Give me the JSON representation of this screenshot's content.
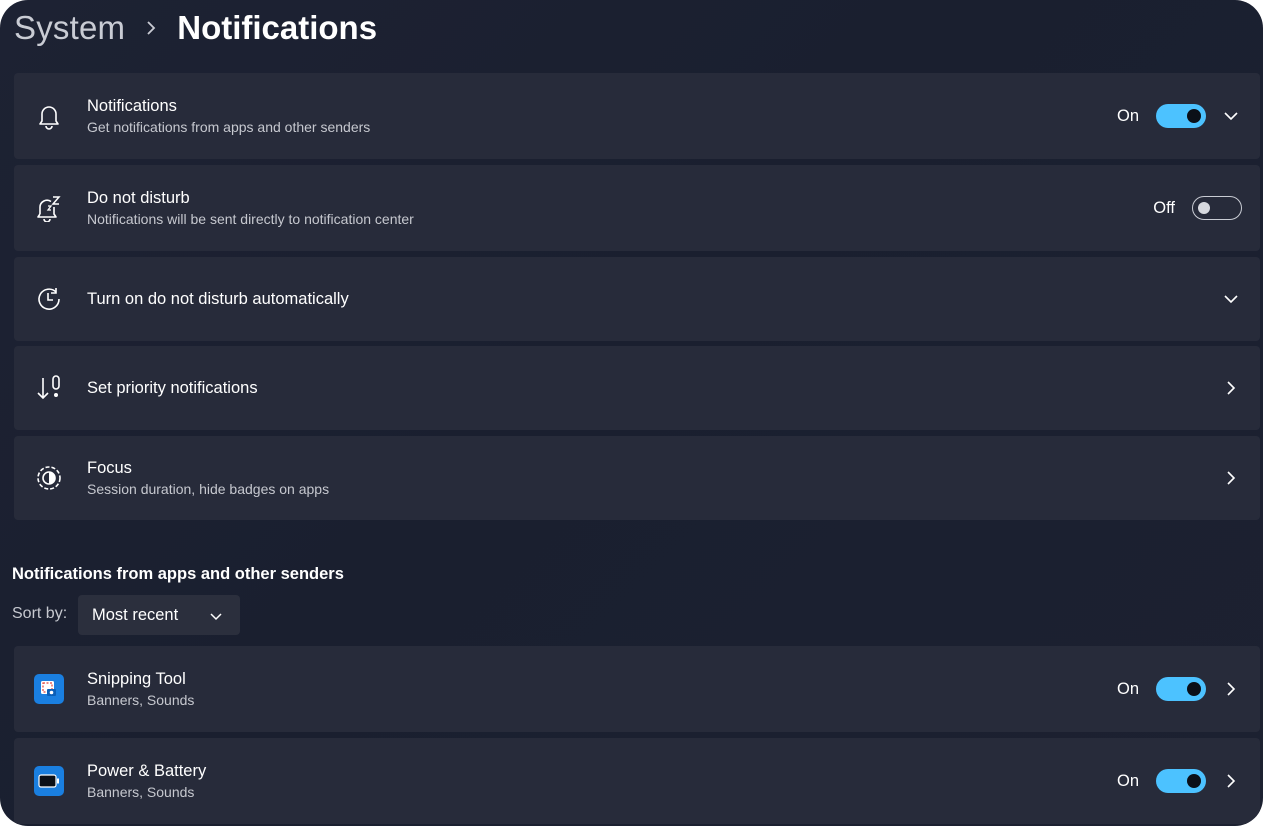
{
  "breadcrumb": {
    "parent": "System",
    "current": "Notifications"
  },
  "colors": {
    "accent": "#4cc2ff",
    "card": "#272b3a",
    "background": "#1d2233"
  },
  "settings": [
    {
      "icon": "bell-icon",
      "title": "Notifications",
      "subtitle": "Get notifications from apps and other senders",
      "state": "On",
      "control": "toggle-on-expand"
    },
    {
      "icon": "bell-snooze-icon",
      "title": "Do not disturb",
      "subtitle": "Notifications will be sent directly to notification center",
      "state": "Off",
      "control": "toggle-off"
    },
    {
      "icon": "clock-refresh-icon",
      "title": "Turn on do not disturb automatically",
      "control": "expand"
    },
    {
      "icon": "priority-sort-icon",
      "title": "Set priority notifications",
      "control": "navigate"
    },
    {
      "icon": "focus-icon",
      "title": "Focus",
      "subtitle": "Session duration, hide badges on apps",
      "control": "navigate"
    }
  ],
  "apps_section": {
    "title": "Notifications from apps and other senders",
    "sort_label": "Sort by:",
    "sort_value": "Most recent"
  },
  "apps": [
    {
      "icon": "snipping-tool-icon",
      "title": "Snipping Tool",
      "subtitle": "Banners, Sounds",
      "state": "On"
    },
    {
      "icon": "battery-icon",
      "title": "Power & Battery",
      "subtitle": "Banners, Sounds",
      "state": "On"
    }
  ]
}
